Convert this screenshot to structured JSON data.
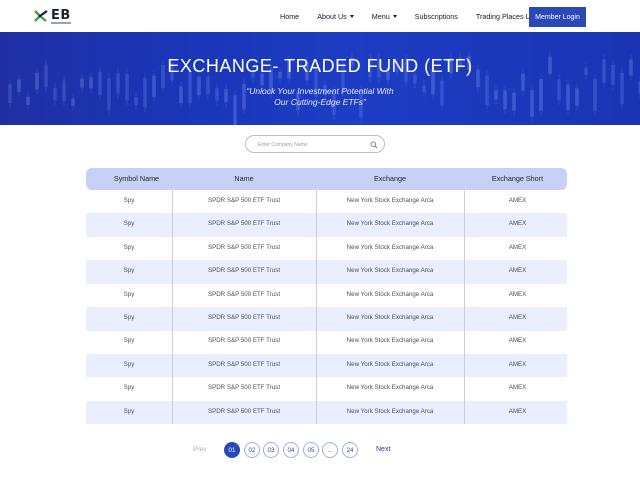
{
  "header": {
    "logo_text": "EB",
    "nav": [
      {
        "label": "Home",
        "has_caret": false
      },
      {
        "label": "About Us",
        "has_caret": true
      },
      {
        "label": "Menu",
        "has_caret": true
      },
      {
        "label": "Subscriptions",
        "has_caret": false
      },
      {
        "label": "Trading Places Live",
        "has_caret": false
      }
    ],
    "login_label": "Member Login"
  },
  "hero": {
    "title": "EXCHANGE- TRADED FUND (ETF)",
    "subtitle_line1": "“Unlock Your Investment Potential With",
    "subtitle_line2": "Our Cutting-Edge ETFs”"
  },
  "search": {
    "placeholder": "Enter Company Name"
  },
  "table": {
    "headers": [
      "Symbol Name",
      "Name",
      "Exchange",
      "Exchange Short"
    ],
    "rows": [
      [
        "Spy",
        "SPDR S&P 500 ETF Trust",
        "New York Stock Exchange Arca",
        "AMEX"
      ],
      [
        "Spy",
        "SPDR S&P 500 ETF Trust",
        "New York Stock Exchange Arca",
        "AMEX"
      ],
      [
        "Spy",
        "SPDR S&P 500 ETF Trust",
        "New York Stock Exchange Arca",
        "AMEX"
      ],
      [
        "Spy",
        "SPDR S&P 500 ETF Trust",
        "New York Stock Exchange Arca",
        "AMEX"
      ],
      [
        "Spy",
        "SPDR S&P 500 ETF Trust",
        "New York Stock Exchange Arca",
        "AMEX"
      ],
      [
        "Spy",
        "SPDR S&P 500 ETF Trust",
        "New York Stock Exchange Arca",
        "AMEX"
      ],
      [
        "Spy",
        "SPDR S&P 500 ETF Trust",
        "New York Stock Exchange Arca",
        "AMEX"
      ],
      [
        "Spy",
        "SPDR S&P 500 ETF Trust",
        "New York Stock Exchange Arca",
        "AMEX"
      ],
      [
        "Spy",
        "SPDR S&P 500 ETF Trust",
        "New York Stock Exchange Arca",
        "AMEX"
      ],
      [
        "Spy",
        "SPDR S&P 500 ETF Trust",
        "New York Stock Exchange Arca",
        "AMEX"
      ]
    ]
  },
  "pagination": {
    "prev_label": "Prev",
    "next_label": "Next",
    "pages": [
      "01",
      "02",
      "03",
      "04",
      "05",
      "...",
      "24"
    ],
    "active": "01"
  },
  "colors": {
    "brand": "#2a48b8",
    "hero": "#1d3dc4",
    "table_header": "#c7d1f5",
    "row_alt": "#e9efff",
    "logo_green": "#3aa64a"
  },
  "icons": {
    "logo": "eb-logo-icon",
    "search": "search-icon",
    "caret": "chevron-down-icon"
  }
}
